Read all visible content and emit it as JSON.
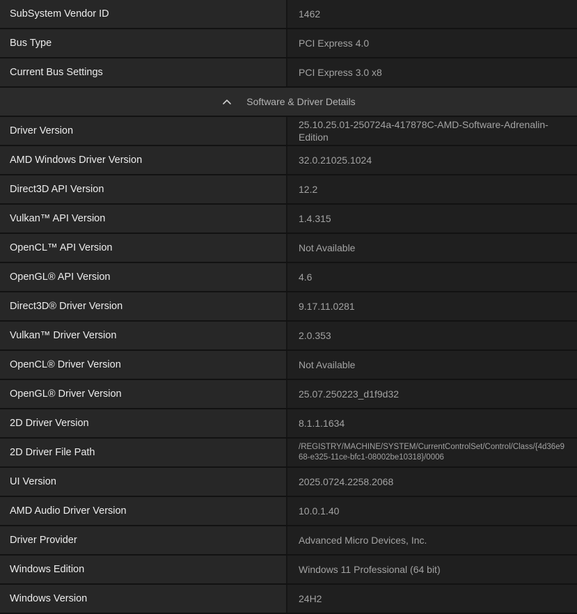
{
  "top_rows": [
    {
      "label": "SubSystem Vendor ID",
      "value": "1462"
    },
    {
      "label": "Bus Type",
      "value": "PCI Express 4.0"
    },
    {
      "label": "Current Bus Settings",
      "value": "PCI Express 3.0 x8"
    }
  ],
  "section": {
    "title": "Software & Driver Details",
    "icon": "chevron-up-icon"
  },
  "rows": [
    {
      "label": "Driver Version",
      "value": "25.10.25.01-250724a-417878C-AMD-Software-Adrenalin-Edition"
    },
    {
      "label": "AMD Windows Driver Version",
      "value": "32.0.21025.1024"
    },
    {
      "label": "Direct3D API Version",
      "value": "12.2"
    },
    {
      "label": "Vulkan™ API Version",
      "value": "1.4.315"
    },
    {
      "label": "OpenCL™ API Version",
      "value": "Not Available"
    },
    {
      "label": "OpenGL® API Version",
      "value": "4.6"
    },
    {
      "label": "Direct3D® Driver Version",
      "value": "9.17.11.0281"
    },
    {
      "label": "Vulkan™ Driver Version",
      "value": "2.0.353"
    },
    {
      "label": "OpenCL® Driver Version",
      "value": "Not Available"
    },
    {
      "label": "OpenGL® Driver Version",
      "value": "25.07.250223_d1f9d32"
    },
    {
      "label": "2D Driver Version",
      "value": "8.1.1.1634"
    },
    {
      "label": "2D Driver File Path",
      "value": "/REGISTRY/MACHINE/SYSTEM/CurrentControlSet/Control/Class/{4d36e968-e325-11ce-bfc1-08002be10318}/0006"
    },
    {
      "label": "UI Version",
      "value": "2025.0724.2258.2068"
    },
    {
      "label": "AMD Audio Driver Version",
      "value": "10.0.1.40"
    },
    {
      "label": "Driver Provider",
      "value": "Advanced Micro Devices, Inc."
    },
    {
      "label": "Windows Edition",
      "value": "Windows 11 Professional (64 bit)"
    },
    {
      "label": "Windows Version",
      "value": "24H2"
    }
  ]
}
